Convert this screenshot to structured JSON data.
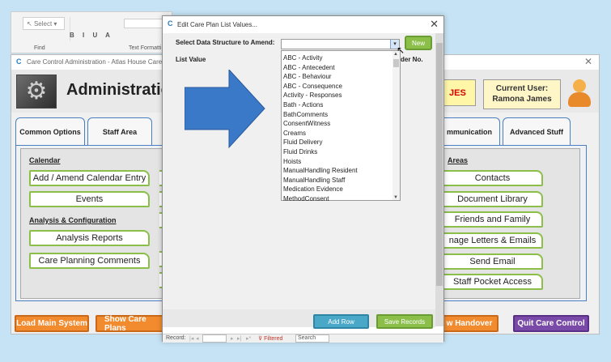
{
  "ribbon": {
    "select_label": "Select",
    "find_label": "Find",
    "text_formatting_label": "Text Formatting",
    "format_letters": "B I U A"
  },
  "admin_window": {
    "title": "Care Control Administration - Atlas House Care Home",
    "heading": "Administration",
    "alert_text": "JES",
    "current_user_label": "Current User:",
    "current_user_name": "Ramona James"
  },
  "tabs": [
    {
      "label": "Common Options"
    },
    {
      "label": "Staff Area"
    },
    {
      "label": "mmunication"
    },
    {
      "label": "Advanced Stuff"
    }
  ],
  "calendar_section": {
    "title": "Calendar",
    "buttons": [
      "Add / Amend Calendar Entry",
      "Events"
    ]
  },
  "analysis_section": {
    "title": "Analysis & Configuration",
    "buttons": [
      "Analysis Reports",
      "Care Planning Comments"
    ]
  },
  "areas_section": {
    "title": "Areas",
    "buttons": [
      "Contacts",
      "Document Library",
      "Friends and Family",
      "nage Letters & Emails",
      "Send Email",
      "Staff Pocket Access"
    ]
  },
  "bottom_bar": {
    "load_main": "Load Main System",
    "show_care_plans": "Show Care Plans",
    "handover": "w Handover",
    "quit": "Quit Care Control"
  },
  "dialog": {
    "title": "Edit Care Plan List Values...",
    "select_label": "Select Data Structure to Amend:",
    "list_value_label": "List Value",
    "order_label": "der No.",
    "new_button": "New",
    "add_row_button": "Add Row",
    "save_button": "Save Records",
    "dropdown_options": [
      "ABC - Activity",
      "ABC - Antecedent",
      "ABC - Behaviour",
      "ABC - Consequence",
      "Activity - Responses",
      "Bath - Actions",
      "BathComments",
      "ConsentWitness",
      "Creams",
      "Fluid Delivery",
      "Fluid Drinks",
      "Hoists",
      "ManualHandling Resident",
      "ManualHandling Staff",
      "Medication Evidence",
      "MethodConsent"
    ],
    "nav": {
      "record_label": "Record:",
      "filtered_label": "Filtered",
      "search_label": "Search"
    }
  },
  "colors": {
    "arrow_blue": "#3a78c8",
    "green_accent": "#8bbf4a",
    "orange_button": "#f28a2e",
    "purple_button": "#7a4aa8",
    "teal_button": "#49a8c7"
  }
}
